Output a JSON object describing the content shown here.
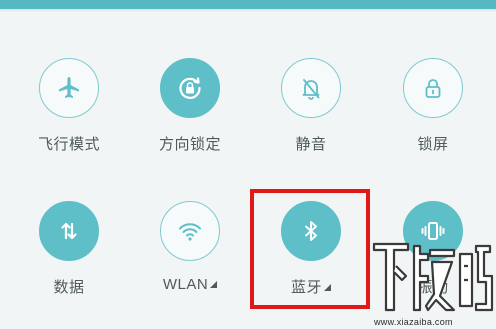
{
  "panel": {
    "accent_color": "#5fbfc9",
    "highlight_color": "#e01818"
  },
  "tiles": [
    {
      "label": "飞行模式",
      "icon": "airplane-icon",
      "active": false
    },
    {
      "label": "方向锁定",
      "icon": "rotation-lock-icon",
      "active": true
    },
    {
      "label": "静音",
      "icon": "mute-bell-icon",
      "active": false
    },
    {
      "label": "锁屏",
      "icon": "lock-icon",
      "active": false
    },
    {
      "label": "数据",
      "icon": "mobile-data-icon",
      "active": true
    },
    {
      "label": "WLAN",
      "icon": "wifi-icon",
      "active": false,
      "has_menu": true
    },
    {
      "label": "蓝牙",
      "icon": "bluetooth-icon",
      "active": true,
      "has_menu": true
    },
    {
      "label": "振动",
      "icon": "vibrate-icon",
      "active": true
    }
  ],
  "watermark": {
    "logo_text": "下载吧",
    "url_text": "www.xiazaiba.com"
  }
}
